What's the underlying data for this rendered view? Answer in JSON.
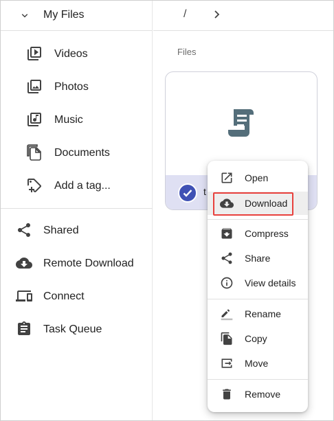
{
  "sidebar": {
    "root_label": "My Files",
    "library": [
      {
        "label": "Videos",
        "icon": "video-library-icon"
      },
      {
        "label": "Photos",
        "icon": "photo-library-icon"
      },
      {
        "label": "Music",
        "icon": "music-library-icon"
      },
      {
        "label": "Documents",
        "icon": "documents-icon"
      },
      {
        "label": "Add a tag...",
        "icon": "add-tag-icon"
      }
    ],
    "tools": [
      {
        "label": "Shared",
        "icon": "share-icon"
      },
      {
        "label": "Remote Download",
        "icon": "cloud-download-icon"
      },
      {
        "label": "Connect",
        "icon": "devices-icon"
      },
      {
        "label": "Task Queue",
        "icon": "clipboard-icon"
      }
    ]
  },
  "breadcrumb": {
    "root": "/"
  },
  "main": {
    "section_title": "Files",
    "file": {
      "name_visible": "t",
      "icon": "script-icon",
      "selected": true
    }
  },
  "context_menu": {
    "items": [
      {
        "label": "Open",
        "icon": "open-in-new-icon"
      },
      {
        "label": "Download",
        "icon": "cloud-download-icon"
      },
      {
        "label": "Compress",
        "icon": "archive-icon"
      },
      {
        "label": "Share",
        "icon": "share-icon"
      },
      {
        "label": "View details",
        "icon": "info-icon"
      },
      {
        "label": "Rename",
        "icon": "pencil-icon"
      },
      {
        "label": "Copy",
        "icon": "copy-icon"
      },
      {
        "label": "Move",
        "icon": "move-icon"
      },
      {
        "label": "Remove",
        "icon": "trash-icon"
      }
    ],
    "active_item": "Download"
  },
  "colors": {
    "accent": "#3f51b5",
    "icon_gray": "#424242",
    "file_icon": "#546e7a",
    "selected_footer": "#dfe0f3",
    "highlight_border": "#e8403c"
  }
}
